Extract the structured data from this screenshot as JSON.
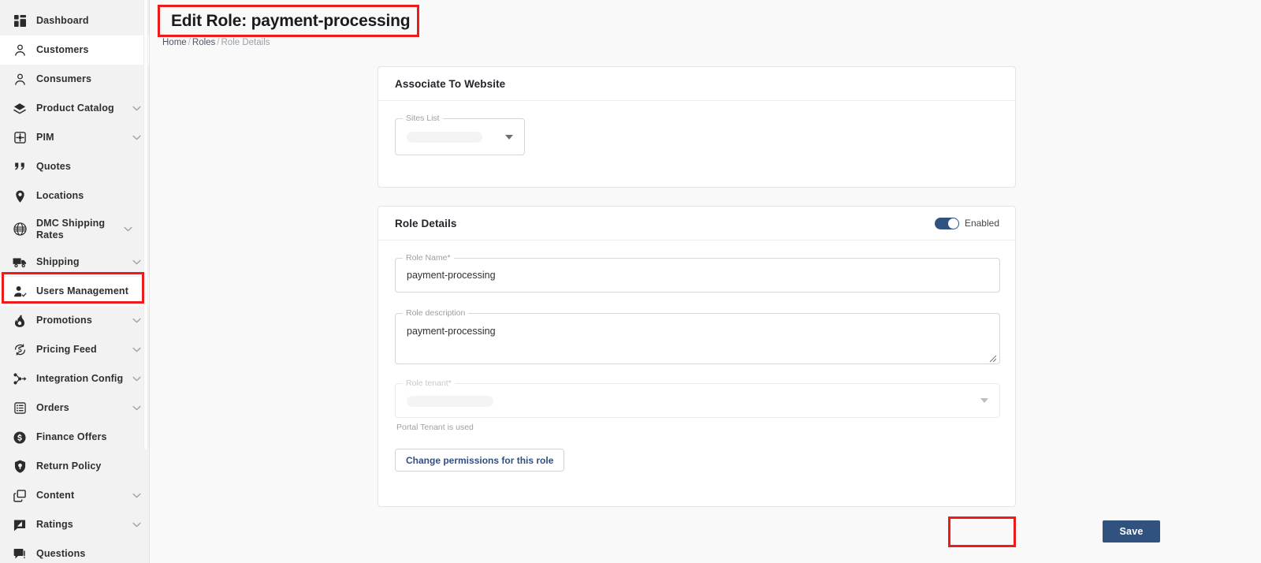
{
  "sidebar": {
    "items": [
      {
        "label": "Dashboard",
        "icon": "dashboard-icon",
        "expandable": false,
        "active": false
      },
      {
        "label": "Customers",
        "icon": "person-icon",
        "expandable": false,
        "active": true
      },
      {
        "label": "Consumers",
        "icon": "person-icon",
        "expandable": false,
        "active": false
      },
      {
        "label": "Product Catalog",
        "icon": "layers-icon",
        "expandable": true,
        "active": false
      },
      {
        "label": "PIM",
        "icon": "settings-square-icon",
        "expandable": true,
        "active": false
      },
      {
        "label": "Quotes",
        "icon": "quote-icon",
        "expandable": false,
        "active": false
      },
      {
        "label": "Locations",
        "icon": "map-pin-icon",
        "expandable": false,
        "active": false
      },
      {
        "label": "DMC Shipping Rates",
        "icon": "globe-icon",
        "expandable": true,
        "active": false
      },
      {
        "label": "Shipping",
        "icon": "truck-icon",
        "expandable": true,
        "active": false
      },
      {
        "label": "Users Management",
        "icon": "user-check-icon",
        "expandable": false,
        "active": true
      },
      {
        "label": "Promotions",
        "icon": "flame-icon",
        "expandable": true,
        "active": false
      },
      {
        "label": "Pricing Feed",
        "icon": "currency-refresh-icon",
        "expandable": true,
        "active": false
      },
      {
        "label": "Integration Config",
        "icon": "integration-icon",
        "expandable": true,
        "active": false
      },
      {
        "label": "Orders",
        "icon": "list-box-icon",
        "expandable": true,
        "active": false
      },
      {
        "label": "Finance Offers",
        "icon": "dollar-circle-icon",
        "expandable": false,
        "active": false
      },
      {
        "label": "Return Policy",
        "icon": "shield-icon",
        "expandable": false,
        "active": false
      },
      {
        "label": "Content",
        "icon": "windows-icon",
        "expandable": true,
        "active": false
      },
      {
        "label": "Ratings",
        "icon": "rating-icon",
        "expandable": true,
        "active": false
      },
      {
        "label": "Questions",
        "icon": "chat-icon",
        "expandable": false,
        "active": false
      }
    ]
  },
  "header": {
    "title": "Edit Role: payment-processing",
    "breadcrumb": {
      "home": "Home",
      "roles": "Roles",
      "current": "Role Details",
      "separator": "/"
    }
  },
  "associate_card": {
    "title": "Associate To Website",
    "sites_list": {
      "label": "Sites List",
      "value": "",
      "icon": "chevron-down-icon"
    }
  },
  "role_details_card": {
    "title": "Role Details",
    "enabled_toggle": {
      "label": "Enabled",
      "state": "on"
    },
    "role_name": {
      "label": "Role Name*",
      "value": "payment-processing"
    },
    "role_description": {
      "label": "Role description",
      "value": "payment-processing"
    },
    "role_tenant": {
      "label": "Role tenant*",
      "value": "",
      "helper": "Portal Tenant is used",
      "disabled": true
    },
    "change_permissions_button": "Change permissions for this role"
  },
  "footer": {
    "save_label": "Save"
  },
  "colors": {
    "accent_navy": "#31517f",
    "highlight_red": "#ef1b1b",
    "sidebar_bg": "#f2f2f2",
    "page_bg": "#f9f9f9"
  }
}
